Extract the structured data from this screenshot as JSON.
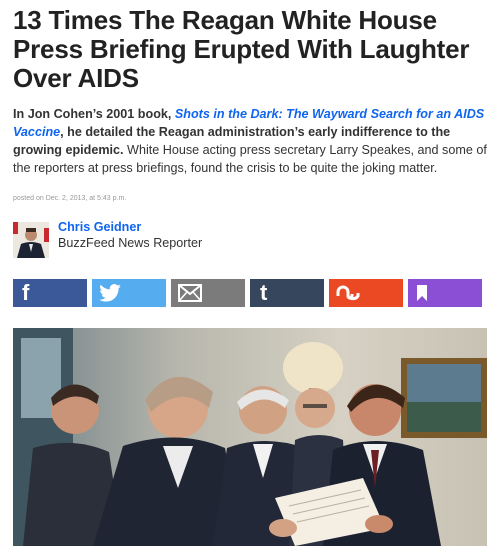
{
  "article": {
    "title": "13 Times The Reagan White House Press Briefing Erupted With Laughter Over AIDS",
    "lede_prefix": "In Jon Cohen’s 2001 book, ",
    "lede_book_link": "Shots in the Dark: The Wayward Search for an AIDS Vaccine",
    "lede_suffix": ", he detailed the Reagan administration’s early indifference to the growing epidemic.",
    "lede_body": " White House acting press secretary Larry Speakes, and some of the reporters at press briefings, found the crisis to be quite the joking matter.",
    "posted": "posted on Dec. 2, 2013, at 5:43 p.m."
  },
  "author": {
    "name": "Chris Geidner",
    "role": "BuzzFeed News Reporter"
  },
  "share": [
    {
      "name": "facebook",
      "glyph": "f",
      "color": "#3b5998"
    },
    {
      "name": "twitter",
      "glyph": "",
      "color": "#55acee"
    },
    {
      "name": "email",
      "glyph": "",
      "color": "#7b7b7b"
    },
    {
      "name": "tumblr",
      "glyph": "t",
      "color": "#36465d"
    },
    {
      "name": "stumbleupon",
      "glyph": "",
      "color": "#eb4924"
    },
    {
      "name": "bookmark",
      "glyph": "",
      "color": "#8b4fd6"
    }
  ],
  "colors": {
    "link": "#0f65ef",
    "title": "#222222"
  }
}
